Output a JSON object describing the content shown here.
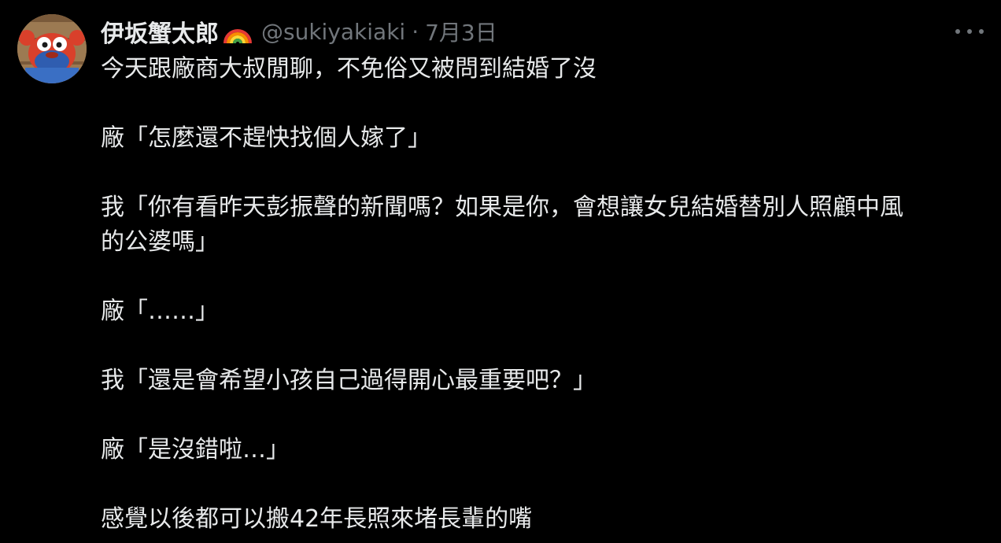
{
  "tweet": {
    "display_name": "伊坂蟹太郎",
    "name_emoji_icon": "rainbow-icon",
    "handle": "@sukiyakiaki",
    "separator": "·",
    "date": "7月3日",
    "more_icon": "more-horizontal-icon",
    "avatar_icon": "cartoon-crab-avatar",
    "lines": [
      "今天跟廠商大叔閒聊，不免俗又被問到結婚了沒",
      "",
      "廠「怎麼還不趕快找個人嫁了」",
      "",
      "我「你有看昨天彭振聲的新聞嗎？如果是你，會想讓女兒結婚替別人照顧中風",
      "的公婆嗎」",
      "",
      "廠「……」",
      "",
      "我「還是會希望小孩自己過得開心最重要吧？」",
      "",
      "廠「是沒錯啦…」",
      "",
      "感覺以後都可以搬42年長照來堵長輩的嘴"
    ]
  },
  "colors": {
    "background": "#000000",
    "primary_text": "#e7e9ea",
    "secondary_text": "#71767b"
  }
}
